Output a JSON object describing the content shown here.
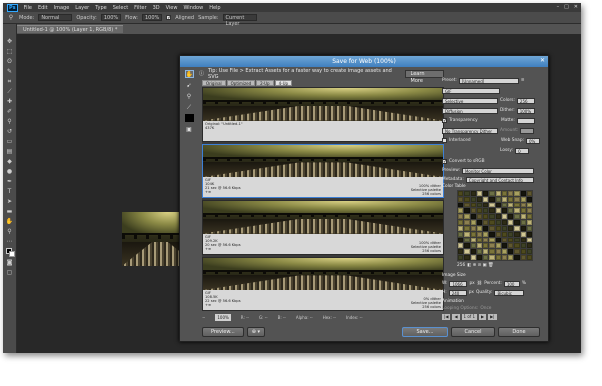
{
  "app": {
    "logo": "Ps",
    "menu": [
      "File",
      "Edit",
      "Image",
      "Layer",
      "Type",
      "Select",
      "Filter",
      "3D",
      "View",
      "Window",
      "Help"
    ],
    "window_controls": [
      "–",
      "□",
      "✕"
    ]
  },
  "options_bar": {
    "mode_label": "Mode:",
    "mode_value": "Normal",
    "opacity_label": "Opacity:",
    "opacity_value": "100%",
    "flow_label": "Flow:",
    "flow_value": "100%",
    "aligned_label": "Aligned",
    "sample_label": "Sample:",
    "sample_value": "Current Layer"
  },
  "document_tab": "Untitled-1 @ 100% (Layer 1, RGB/8) *",
  "dialog": {
    "title": "Save for Web (100%)",
    "tip": "Tip: Use File > Extract Assets for a faster way to create image assets and SVG",
    "learn_more": "Learn More",
    "view_tabs": [
      "Original",
      "Optimized",
      "2-Up",
      "4-Up"
    ],
    "panes": [
      {
        "left": [
          "Original: \"Untitled-1\"",
          "437K"
        ],
        "right": []
      },
      {
        "left": [
          "GIF",
          "104K",
          "21 sec @ 56.6 Kbps",
          "+≡"
        ],
        "right": [
          "100% dither",
          "Selective palette",
          "256 colors"
        ]
      },
      {
        "left": [
          "GIF",
          "109.2K",
          "20 sec @ 56.6 Kbps",
          "+≡"
        ],
        "right": [
          "100% dither",
          "Selective palette",
          "256 colors"
        ]
      },
      {
        "left": [
          "GIF",
          "108.5K",
          "22 sec @ 56.6 Kbps",
          "+≡"
        ],
        "right": [
          "0% dither",
          "Selective palette",
          "256 colors"
        ]
      }
    ],
    "status": {
      "zoom": "100%",
      "r": "R: --",
      "g": "G: --",
      "b": "B: --",
      "alpha": "Alpha: --",
      "hex": "Hex: --",
      "index": "Index: --"
    },
    "buttons": {
      "preview": "Preview...",
      "browser": "⊕ ▾",
      "save": "Save...",
      "cancel": "Cancel",
      "done": "Done"
    },
    "settings": {
      "preset_label": "Preset:",
      "preset_value": "[Unnamed]",
      "format_value": "GIF",
      "reduction_value": "Selective",
      "colors_label": "Colors:",
      "colors_value": "256",
      "dither_algo_value": "Diffusion",
      "dither_label": "Dither:",
      "dither_value": "100%",
      "transparency_label": "Transparency",
      "matte_label": "Matte:",
      "trans_dither_value": "No Transparency Dither",
      "amount_label": "Amount:",
      "interlaced_label": "Interlaced",
      "websnap_label": "Web Snap:",
      "websnap_value": "0%",
      "lossy_label": "Lossy:",
      "lossy_value": "0",
      "convert_srgb_label": "Convert to sRGB",
      "preview_label": "Preview:",
      "preview_value": "Monitor Color",
      "metadata_label": "Metadata:",
      "metadata_value": "Copyright and Contact Info",
      "color_table_label": "Color Table",
      "color_count": "256",
      "image_size_label": "Image Size",
      "w_label": "W:",
      "w_value": "1066",
      "h_label": "H:",
      "h_value": "240",
      "px": "px",
      "percent_label": "Percent:",
      "percent_value": "100",
      "pct": "%",
      "quality_label": "Quality:",
      "quality_value": "Bicubic",
      "animation_label": "Animation",
      "looping_label": "Looping Options:",
      "looping_value": "Once",
      "frame_counter": "1 of 1"
    }
  },
  "colors": {
    "app_bg": "#535353",
    "workspace_bg": "#282828",
    "titlebar": "#3f7fbf"
  }
}
